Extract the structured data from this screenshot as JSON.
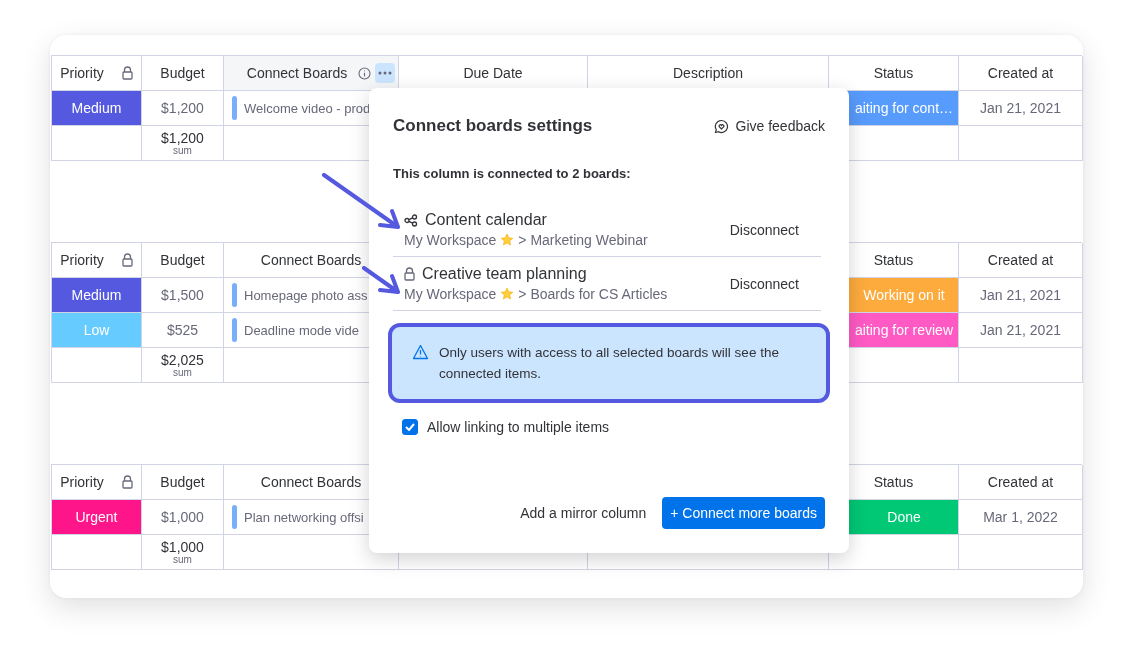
{
  "groups": [
    {
      "headers": [
        {
          "kind": "locked",
          "label": "Priority"
        },
        {
          "kind": "text",
          "label": "Budget"
        },
        {
          "kind": "active",
          "label": "Connect Boards"
        },
        {
          "kind": "text",
          "label": "Due Date"
        },
        {
          "kind": "text",
          "label": "Description"
        },
        {
          "kind": "text",
          "label": "Status"
        },
        {
          "kind": "text",
          "label": "Created at"
        }
      ],
      "rows": [
        {
          "priority": {
            "label": "Medium",
            "color": "#5559df"
          },
          "budget": "$1,200",
          "item": "Welcome video - prod",
          "status": {
            "label": "aiting for cont…",
            "color": "#579bfc"
          },
          "created": "Jan 21, 2021"
        }
      ],
      "sum": {
        "value": "$1,200",
        "label": "sum"
      }
    },
    {
      "headers": [
        {
          "kind": "locked",
          "label": "Priority"
        },
        {
          "kind": "text",
          "label": "Budget"
        },
        {
          "kind": "text",
          "label": "Connect Boards"
        },
        {
          "kind": "blank"
        },
        {
          "kind": "blank"
        },
        {
          "kind": "text",
          "label": "Status"
        },
        {
          "kind": "text",
          "label": "Created at"
        }
      ],
      "rows": [
        {
          "priority": {
            "label": "Medium",
            "color": "#5559df"
          },
          "budget": "$1,500",
          "item": "Homepage photo ass",
          "status": {
            "label": "Working on it",
            "color": "#fdab3d"
          },
          "created": "Jan 21, 2021"
        },
        {
          "priority": {
            "label": "Low",
            "color": "#66ccff"
          },
          "budget": "$525",
          "item": "Deadline mode vide",
          "status": {
            "label": "aiting for review",
            "color": "#ff5ac4"
          },
          "created": "Jan 21, 2021"
        }
      ],
      "sum": {
        "value": "$2,025",
        "label": "sum"
      }
    },
    {
      "headers": [
        {
          "kind": "locked",
          "label": "Priority"
        },
        {
          "kind": "text",
          "label": "Budget"
        },
        {
          "kind": "text",
          "label": "Connect Boards"
        },
        {
          "kind": "blank"
        },
        {
          "kind": "blank"
        },
        {
          "kind": "text",
          "label": "Status"
        },
        {
          "kind": "text",
          "label": "Created at"
        }
      ],
      "rows": [
        {
          "priority": {
            "label": "Urgent",
            "color": "#ff158a"
          },
          "budget": "$1,000",
          "item": "Plan networking offsi",
          "status": {
            "label": "Done",
            "color": "#00c875"
          },
          "created": "Mar 1, 2022"
        }
      ],
      "sum": {
        "value": "$1,000",
        "label": "sum"
      }
    }
  ],
  "dialog": {
    "title": "Connect boards settings",
    "feedback": "Give feedback",
    "subtitle": "This column is connected to 2 boards:",
    "boards": [
      {
        "kind": "shared",
        "name": "Content calendar",
        "workspace": "My Workspace",
        "board": "> Marketing Webinar",
        "action": "Disconnect"
      },
      {
        "kind": "locked",
        "name": "Creative team planning",
        "workspace": "My Workspace",
        "board": "> Boards for CS Articles",
        "action": "Disconnect"
      }
    ],
    "notice": "Only users with access to all selected boards will see the connected items.",
    "checkbox": {
      "label": "Allow linking to multiple items",
      "checked": true
    },
    "secondary_button": "Add a mirror column",
    "primary_button": "+ Connect more boards"
  }
}
